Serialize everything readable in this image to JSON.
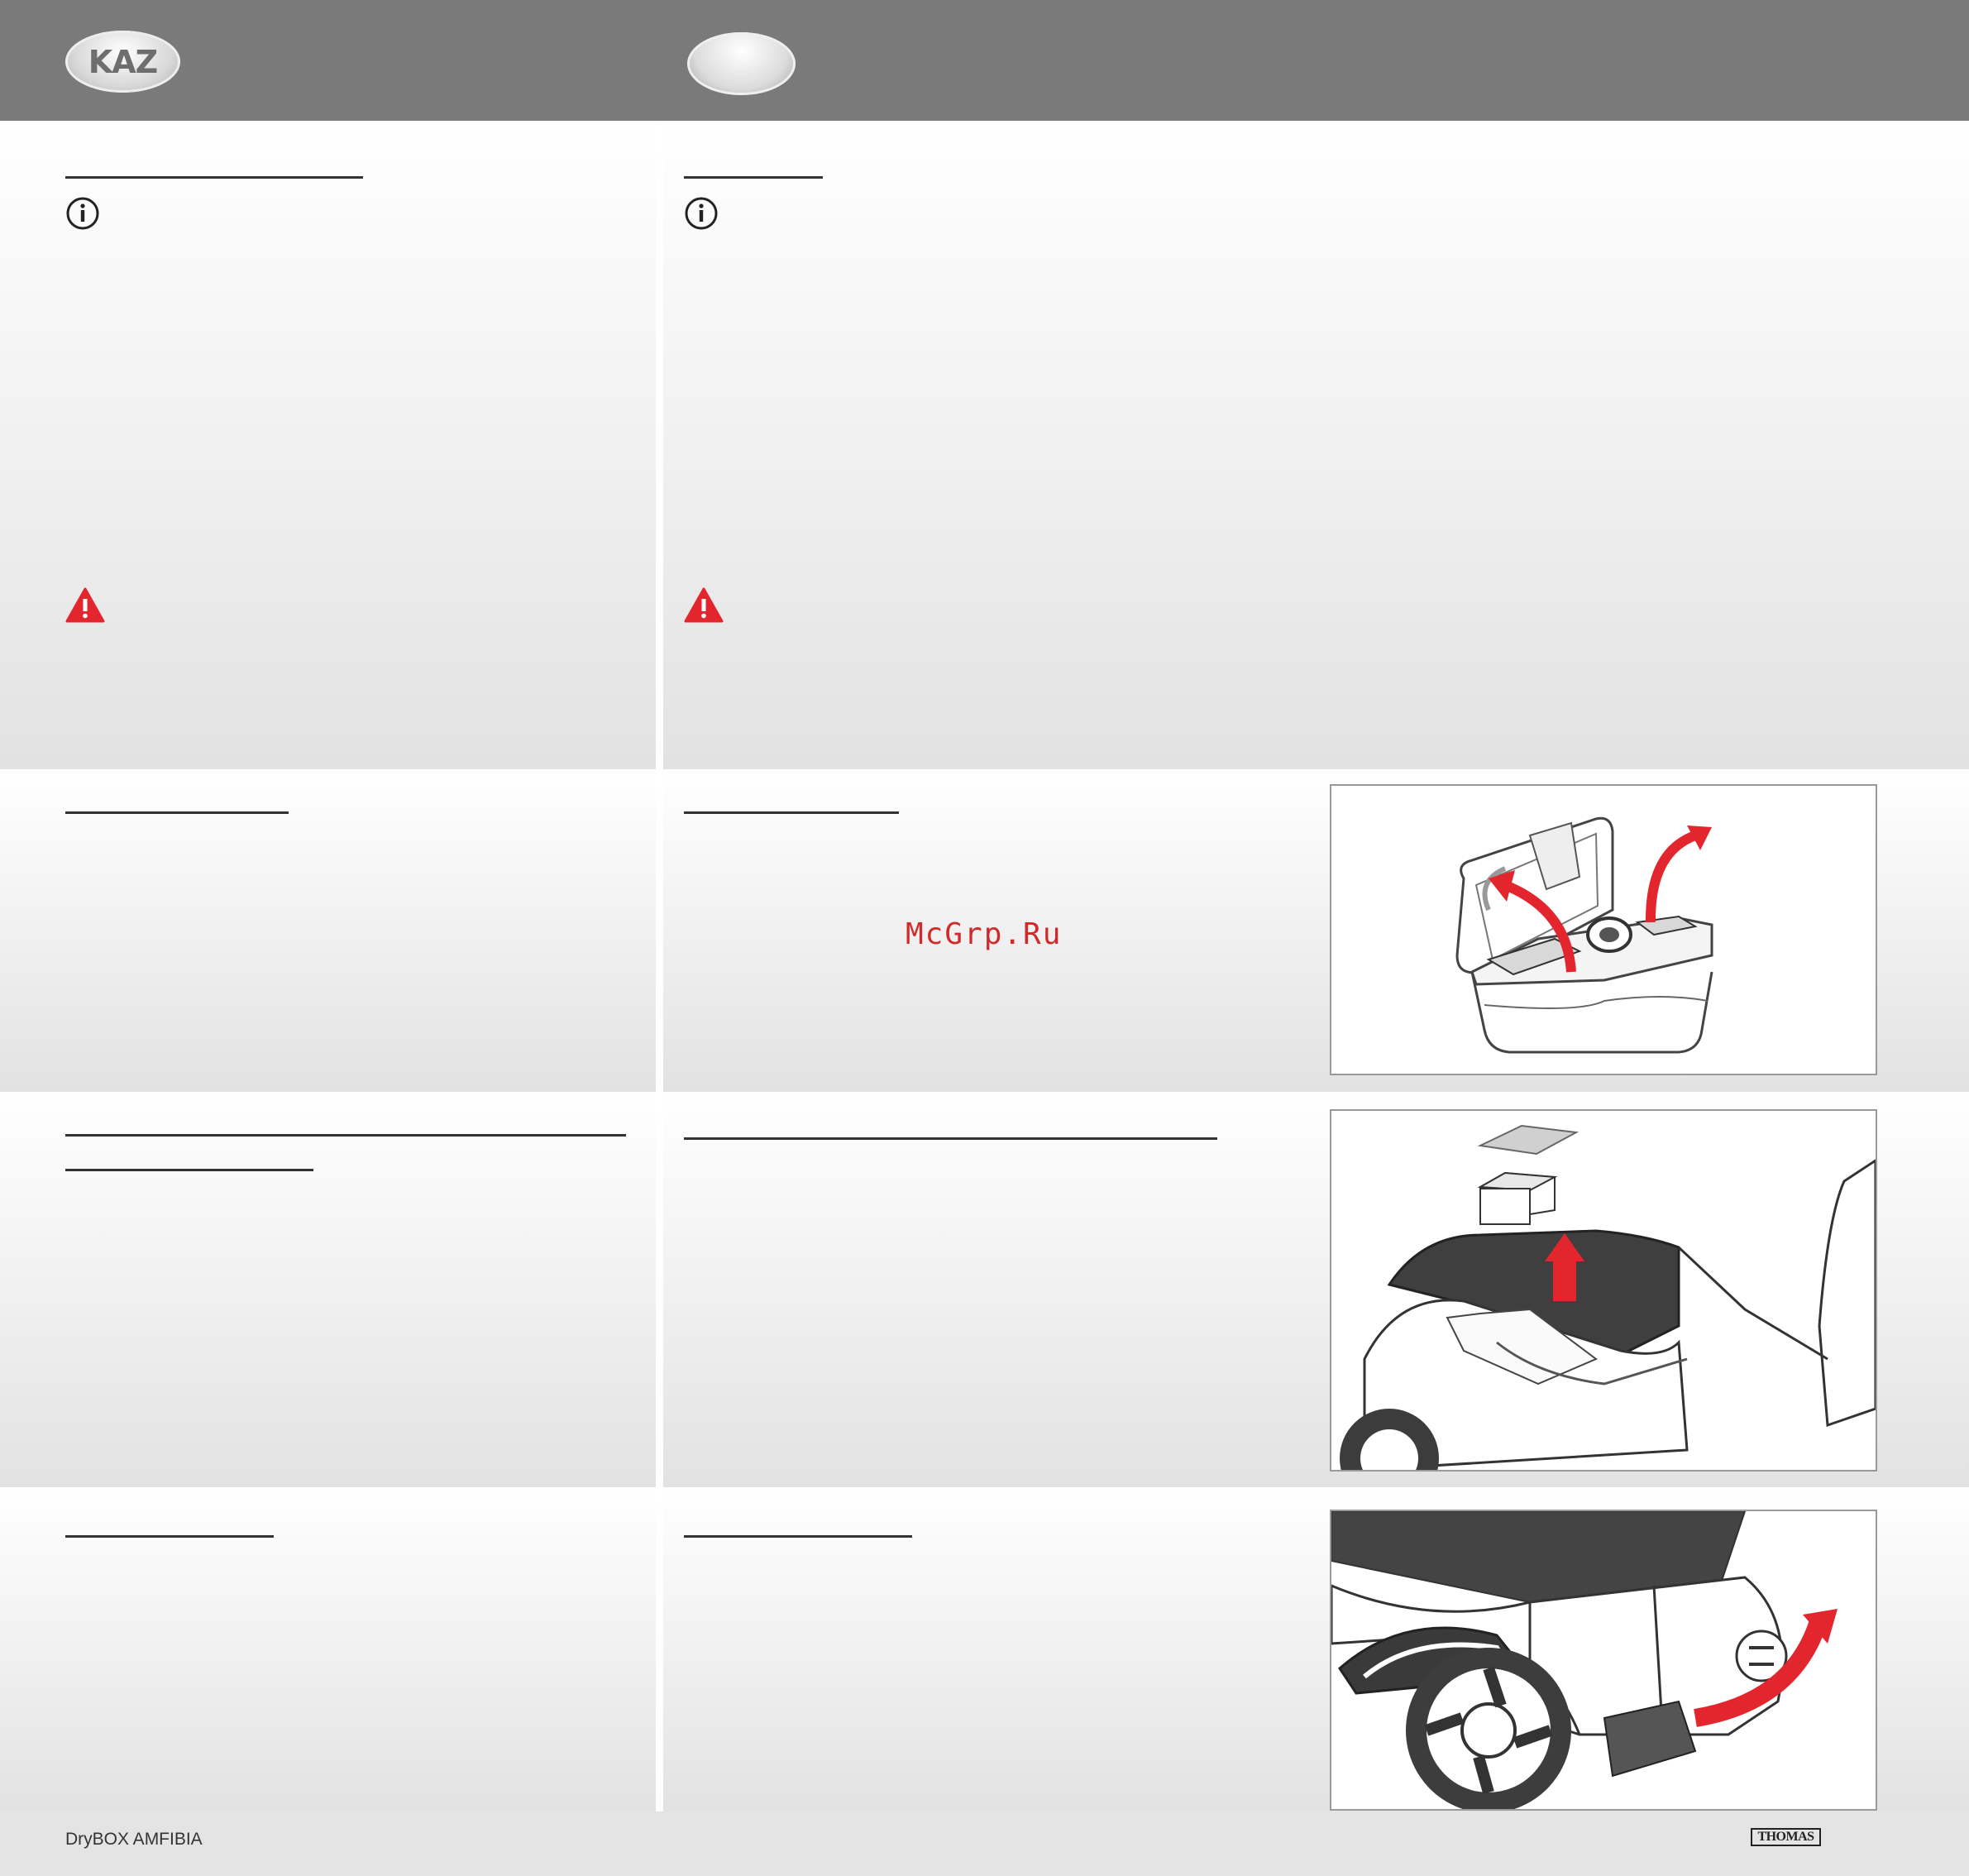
{
  "header": {
    "logo_left_text": "KAZ"
  },
  "watermark": "McGrp.Ru",
  "footer": {
    "model": "DryBOX AMFIBIA",
    "brand": "THOMAS"
  },
  "icons": {
    "info": "info-circle-icon",
    "warning": "warning-triangle-icon",
    "warning_color": "#e3262d",
    "arrow_color": "#e3262d"
  }
}
